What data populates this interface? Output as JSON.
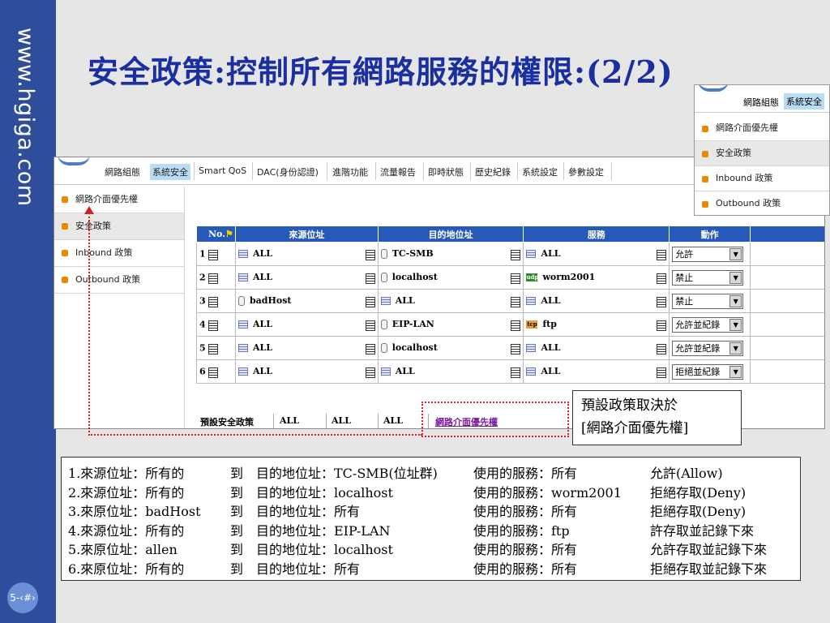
{
  "sideband": {
    "url": "www.hgiga.com",
    "page_number": "5-‹#›"
  },
  "title": "安全政策:控制所有網路服務的權限:(2/2)",
  "main_shot": {
    "nav": [
      "網路組態",
      "系統安全",
      "Smart QoS",
      "DAC(身份認證)",
      "進階功能",
      "流量報告",
      "即時狀態",
      "歷史紀錄",
      "系統設定",
      "參數設定"
    ],
    "nav_active": "系統安全",
    "side_menu": [
      "網路介面優先權",
      "安全政策",
      "Inbound 政策",
      "Outbound 政策"
    ],
    "side_selected": "安全政策",
    "table": {
      "headers": [
        "No.",
        "來源位址",
        "目的地位址",
        "服務",
        "動作"
      ],
      "rows": [
        {
          "no": "1",
          "src": "ALL",
          "src_icon": "list-icon",
          "dst": "TC-SMB",
          "dst_icon": "host-icon",
          "svc": "ALL",
          "svc_icon": "list-icon",
          "action": "允許"
        },
        {
          "no": "2",
          "src": "ALL",
          "src_icon": "list-icon",
          "dst": "localhost",
          "dst_icon": "host-icon",
          "svc": "worm2001",
          "svc_icon": "udp-icon",
          "action": "禁止"
        },
        {
          "no": "3",
          "src": "badHost",
          "src_icon": "host-icon",
          "dst": "ALL",
          "dst_icon": "list-icon",
          "svc": "ALL",
          "svc_icon": "list-icon",
          "action": "禁止"
        },
        {
          "no": "4",
          "src": "ALL",
          "src_icon": "list-icon",
          "dst": "EIP-LAN",
          "dst_icon": "host-icon",
          "svc": "ftp",
          "svc_icon": "tcp-icon",
          "action": "允許並紀錄"
        },
        {
          "no": "5",
          "src": "ALL",
          "src_icon": "list-icon",
          "dst": "localhost",
          "dst_icon": "host-icon",
          "svc": "ALL",
          "svc_icon": "list-icon",
          "action": "允許並紀錄"
        },
        {
          "no": "6",
          "src": "ALL",
          "src_icon": "list-icon",
          "dst": "ALL",
          "dst_icon": "list-icon",
          "svc": "ALL",
          "svc_icon": "list-icon",
          "action": "拒絕並紀錄"
        }
      ],
      "icon_labels": {
        "udp": "udp",
        "tcp": "tcp"
      }
    },
    "default_policy": {
      "label": "預設安全政策",
      "v1": "ALL",
      "v2": "ALL",
      "v3": "ALL",
      "link": "網路介面優先權"
    }
  },
  "sub_shot": {
    "nav": [
      "網路組態",
      "系統安全"
    ],
    "menu": [
      "網路介面優先權",
      "安全政策",
      "Inbound 政策",
      "Outbound 政策"
    ],
    "selected": "安全政策"
  },
  "callout": {
    "line1": "預設政策取決於",
    "line2": "[網路介面優先權]"
  },
  "notes": [
    [
      "1.來源位址：所有的",
      "到",
      "目的地位址：TC-SMB(位址群)",
      "使用的服務：所有",
      "允許(Allow)"
    ],
    [
      "2.來源位址：所有的",
      "到",
      "目的地位址：localhost",
      "使用的服務：worm2001",
      "拒絕存取(Deny)"
    ],
    [
      "3.來原位址：badHost",
      "到",
      "目的地位址：所有",
      "使用的服務：所有",
      "拒絕存取(Deny)"
    ],
    [
      "4.來源位址：所有的",
      "到",
      "目的地位址：EIP-LAN",
      "使用的服務：ftp",
      "許存取並記錄下來"
    ],
    [
      "5.來原位址：allen",
      "到",
      "目的地位址：localhost",
      "使用的服務：所有",
      "允許存取並記錄下來"
    ],
    [
      "6.來原位址：所有的",
      "到",
      "目的地位址：所有",
      "使用的服務：所有",
      "拒絕存取並記錄下來"
    ]
  ],
  "colors": {
    "sideband": "#2e4d9b",
    "title": "#1a2fa0",
    "table_header": "#2659b8",
    "accent_red": "#d62020",
    "nav_active": "#b8dcf3"
  }
}
